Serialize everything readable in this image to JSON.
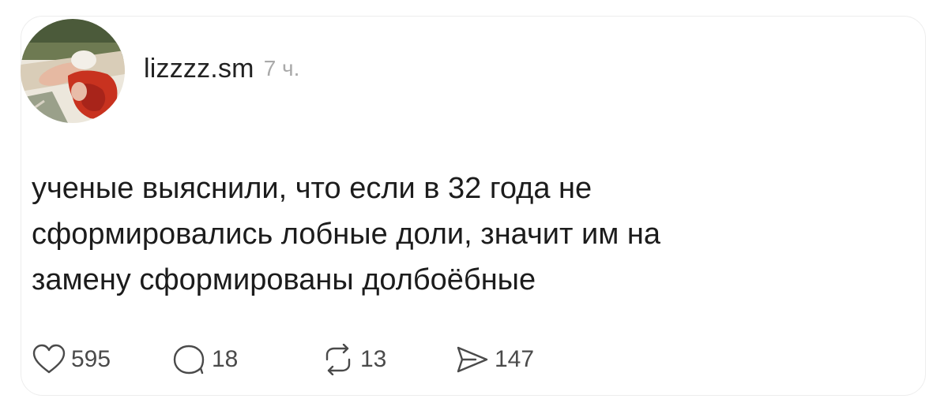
{
  "post": {
    "username": "lizzzz.sm",
    "time": "7 ч.",
    "text_lines": [
      "ученые выяснили, что если в 32 года не",
      "сформировались лобные доли, значит им на",
      "замену сформированы долбоёбные"
    ]
  },
  "actions": {
    "likes": "595",
    "replies": "18",
    "reposts": "13",
    "shares": "147"
  },
  "icons": {
    "like": "heart-icon",
    "reply": "speech-bubble-icon",
    "repost": "repost-arrows-icon",
    "share": "send-arrow-icon"
  },
  "colors": {
    "text": "#1c1c1c",
    "muted": "#a9a9a9",
    "icon": "#4a4a4a",
    "avatar_hair": "#c8321f"
  }
}
